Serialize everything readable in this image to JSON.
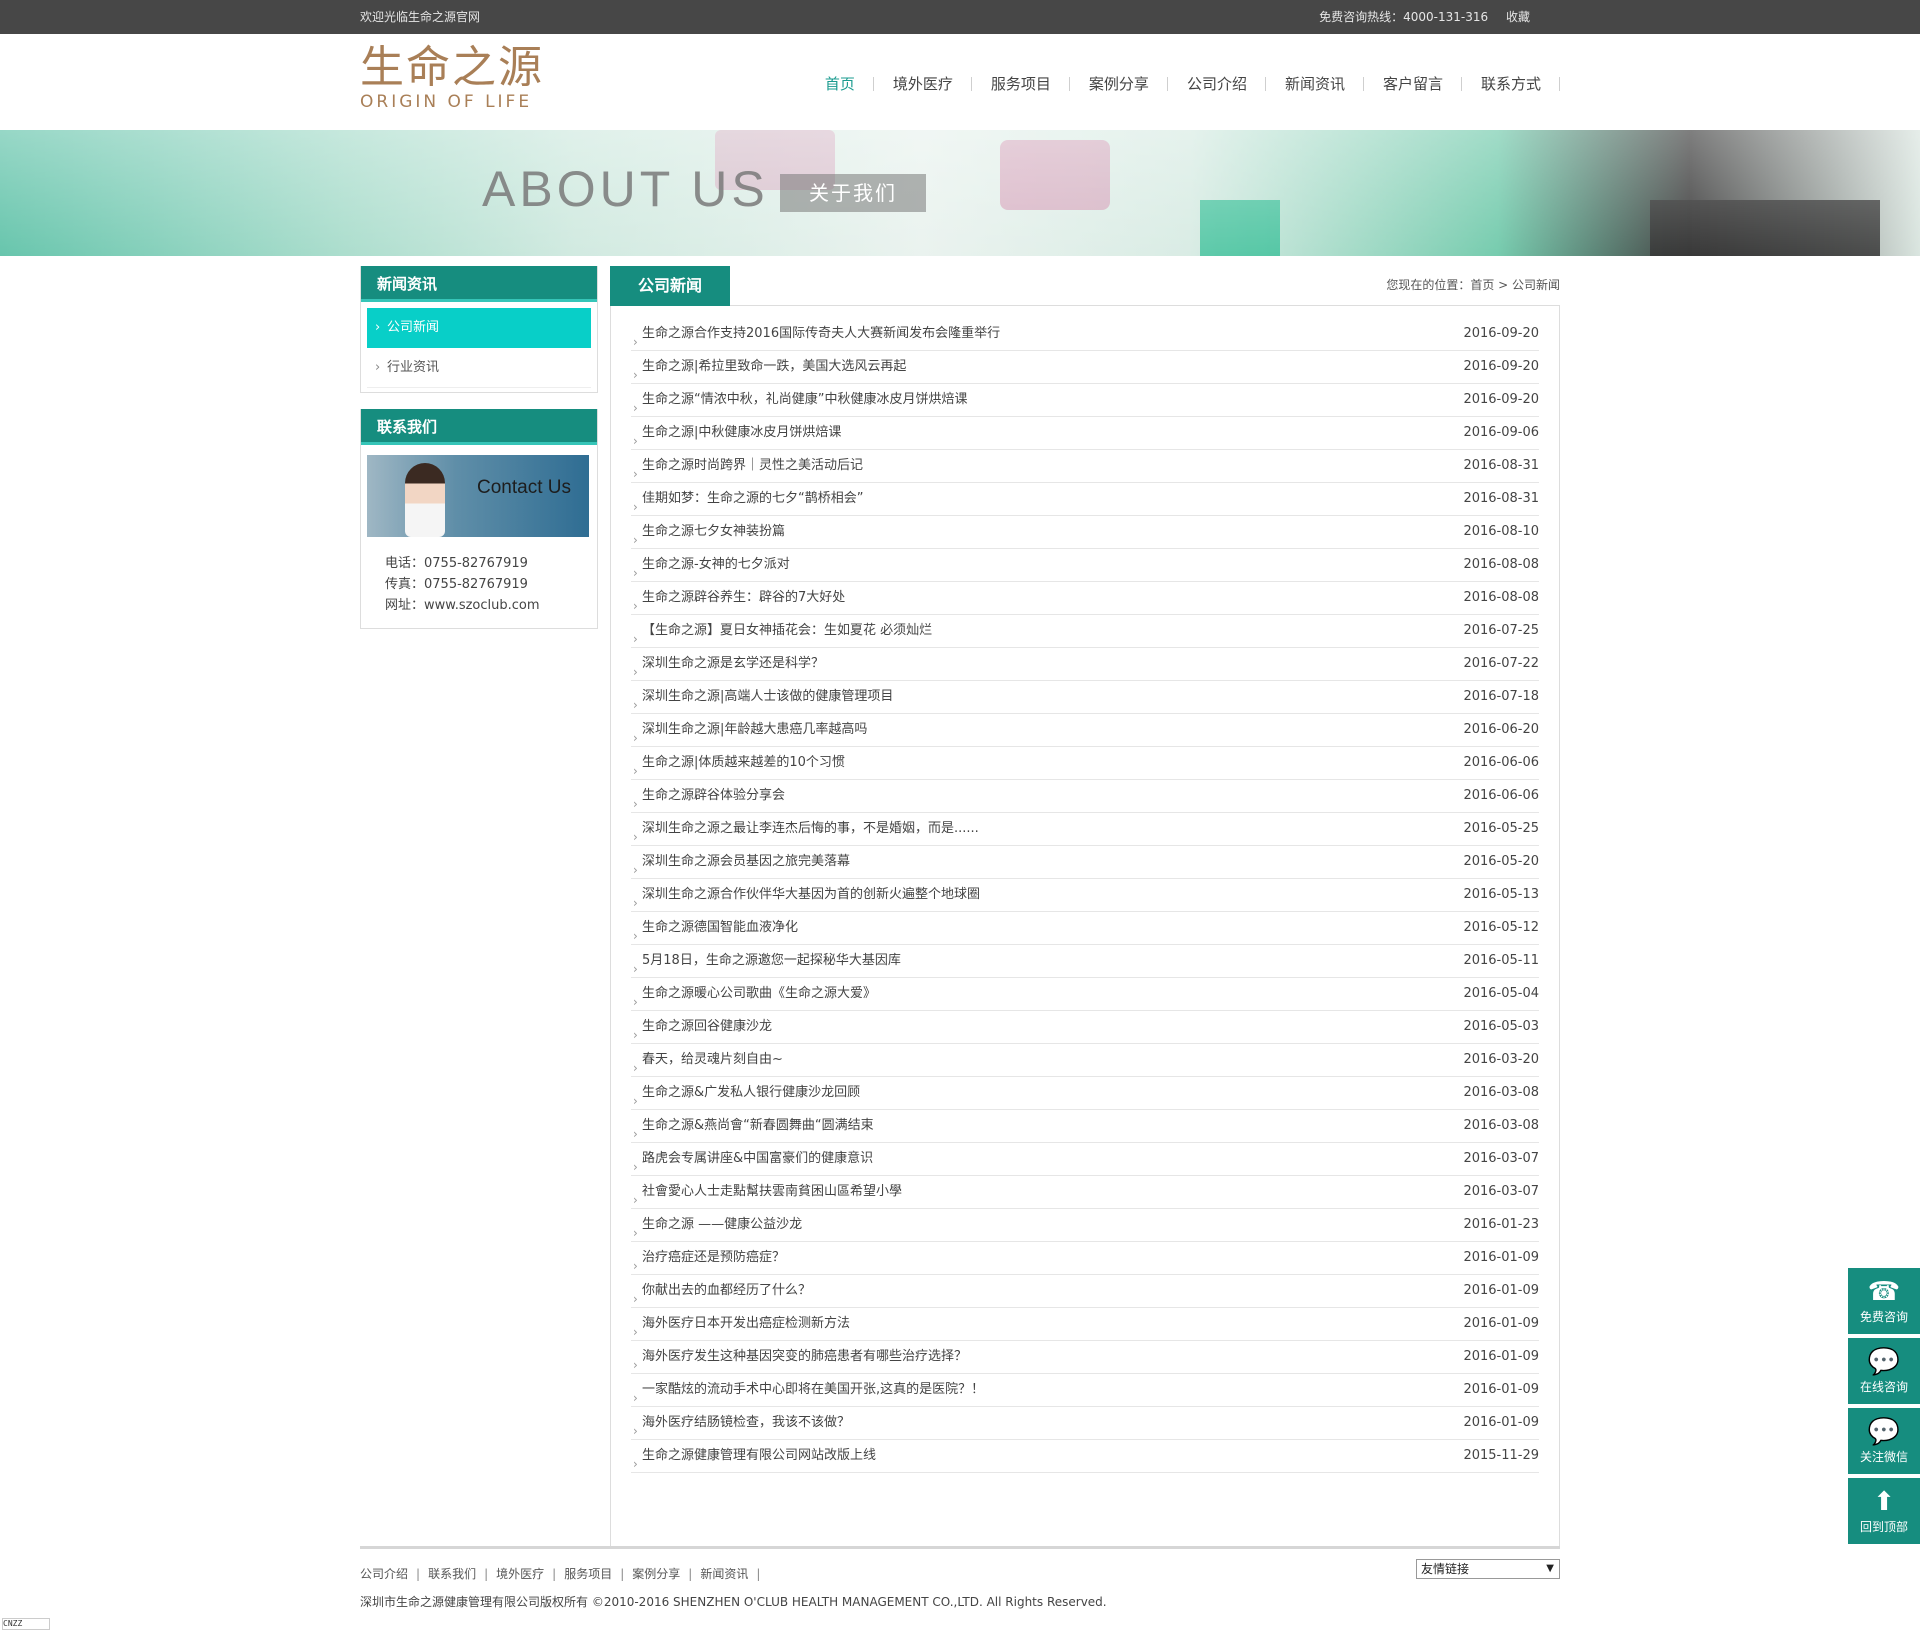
{
  "topbar": {
    "welcome": "欢迎光临生命之源官网",
    "hotline": "免费咨询热线：4000-131-316",
    "favorite": "收藏"
  },
  "logo": {
    "cn": "生命之源",
    "en": "ORIGIN OF LIFE"
  },
  "nav": [
    {
      "label": "首页",
      "active": true
    },
    {
      "label": "境外医疗"
    },
    {
      "label": "服务项目"
    },
    {
      "label": "案例分享"
    },
    {
      "label": "公司介绍"
    },
    {
      "label": "新闻资讯"
    },
    {
      "label": "客户留言"
    },
    {
      "label": "联系方式"
    }
  ],
  "banner": {
    "title": "ABOUT US",
    "subtitle": "关于我们"
  },
  "sidebar": {
    "news_title": "新闻资讯",
    "subnav": [
      {
        "label": "公司新闻",
        "active": true
      },
      {
        "label": "行业资讯"
      }
    ],
    "contact_title": "联系我们",
    "contact_image_text": "Contact Us",
    "phone": "电话：0755-82767919",
    "fax": "传真：0755-82767919",
    "web": "网址：www.szoclub.com"
  },
  "content": {
    "tab": "公司新闻",
    "breadcrumb": "您现在的位置：首页 > 公司新闻",
    "news": [
      {
        "title": "生命之源合作支持2016国际传奇夫人大赛新闻发布会隆重举行",
        "date": "2016-09-20"
      },
      {
        "title": "生命之源|希拉里致命一跌，美国大选风云再起",
        "date": "2016-09-20"
      },
      {
        "title": "生命之源“情浓中秋，礼尚健康”中秋健康冰皮月饼烘焙课",
        "date": "2016-09-20"
      },
      {
        "title": "生命之源|中秋健康冰皮月饼烘焙课",
        "date": "2016-09-06"
      },
      {
        "title": "生命之源时尚跨界｜灵性之美活动后记",
        "date": "2016-08-31"
      },
      {
        "title": "佳期如梦：生命之源的七夕“鹊桥相会”",
        "date": "2016-08-31"
      },
      {
        "title": "生命之源七夕女神装扮篇",
        "date": "2016-08-10"
      },
      {
        "title": "生命之源-女神的七夕派对",
        "date": "2016-08-08"
      },
      {
        "title": "生命之源辟谷养生：辟谷的7大好处",
        "date": "2016-08-08"
      },
      {
        "title": "【生命之源】夏日女神插花会：生如夏花 必须灿烂",
        "date": "2016-07-25"
      },
      {
        "title": "深圳生命之源是玄学还是科学？",
        "date": "2016-07-22"
      },
      {
        "title": "深圳生命之源|高端人士该做的健康管理项目",
        "date": "2016-07-18"
      },
      {
        "title": "深圳生命之源|年龄越大患癌几率越高吗",
        "date": "2016-06-20"
      },
      {
        "title": "生命之源|体质越来越差的10个习惯",
        "date": "2016-06-06"
      },
      {
        "title": "生命之源辟谷体验分享会",
        "date": "2016-06-06"
      },
      {
        "title": "深圳生命之源之最让李连杰后悔的事，不是婚姻，而是......",
        "date": "2016-05-25"
      },
      {
        "title": "深圳生命之源会员基因之旅完美落幕",
        "date": "2016-05-20"
      },
      {
        "title": "深圳生命之源合作伙伴华大基因为首的创新火遍整个地球圈",
        "date": "2016-05-13"
      },
      {
        "title": "生命之源德国智能血液净化",
        "date": "2016-05-12"
      },
      {
        "title": "5月18日，生命之源邀您一起探秘华大基因库",
        "date": "2016-05-11"
      },
      {
        "title": "生命之源暖心公司歌曲《生命之源大爱》",
        "date": "2016-05-04"
      },
      {
        "title": "生命之源回谷健康沙龙",
        "date": "2016-05-03"
      },
      {
        "title": "春天，给灵魂片刻自由~",
        "date": "2016-03-20"
      },
      {
        "title": "生命之源&广发私人银行健康沙龙回顾",
        "date": "2016-03-08"
      },
      {
        "title": "生命之源&燕尚會“新春圆舞曲“圆满结束",
        "date": "2016-03-08"
      },
      {
        "title": "路虎会专属讲座&中国富豪们的健康意识",
        "date": "2016-03-07"
      },
      {
        "title": "社會愛心人士走點幫扶雲南貧困山區希望小學",
        "date": "2016-03-07"
      },
      {
        "title": "生命之源 ——健康公益沙龙",
        "date": "2016-01-23"
      },
      {
        "title": "治疗癌症还是预防癌症？",
        "date": "2016-01-09"
      },
      {
        "title": "你献出去的血都经历了什么？",
        "date": "2016-01-09"
      },
      {
        "title": "海外医疗日本开发出癌症检测新方法",
        "date": "2016-01-09"
      },
      {
        "title": "海外医疗发生这种基因突变的肺癌患者有哪些治疗选择？",
        "date": "2016-01-09"
      },
      {
        "title": "一家酷炫的流动手术中心即将在美国开张,这真的是医院？！",
        "date": "2016-01-09"
      },
      {
        "title": "海外医疗结肠镜检查，我该不该做？",
        "date": "2016-01-09"
      },
      {
        "title": "生命之源健康管理有限公司网站改版上线",
        "date": "2015-11-29"
      }
    ]
  },
  "footer": {
    "links": [
      "公司介绍",
      "联系我们",
      "境外医疗",
      "服务项目",
      "案例分享",
      "新闻资讯"
    ],
    "friend_links": "友情链接",
    "copyright": "深圳市生命之源健康管理有限公司版权所有 ©2010-2016 SHENZHEN O'CLUB HEALTH MANAGEMENT CO.,LTD. All Rights Reserved."
  },
  "cnzz": "CNZZ",
  "float": [
    {
      "label": "免费咨询",
      "icon": "phone-icon"
    },
    {
      "label": "在线咨询",
      "icon": "chat-icon"
    },
    {
      "label": "关注微信",
      "icon": "wechat-icon"
    },
    {
      "label": "回到顶部",
      "icon": "arrow-up-icon"
    }
  ],
  "colors": {
    "brand": "#168d7f",
    "accent": "#08cfc8",
    "logo": "#a97f57",
    "topbar": "#474747"
  }
}
